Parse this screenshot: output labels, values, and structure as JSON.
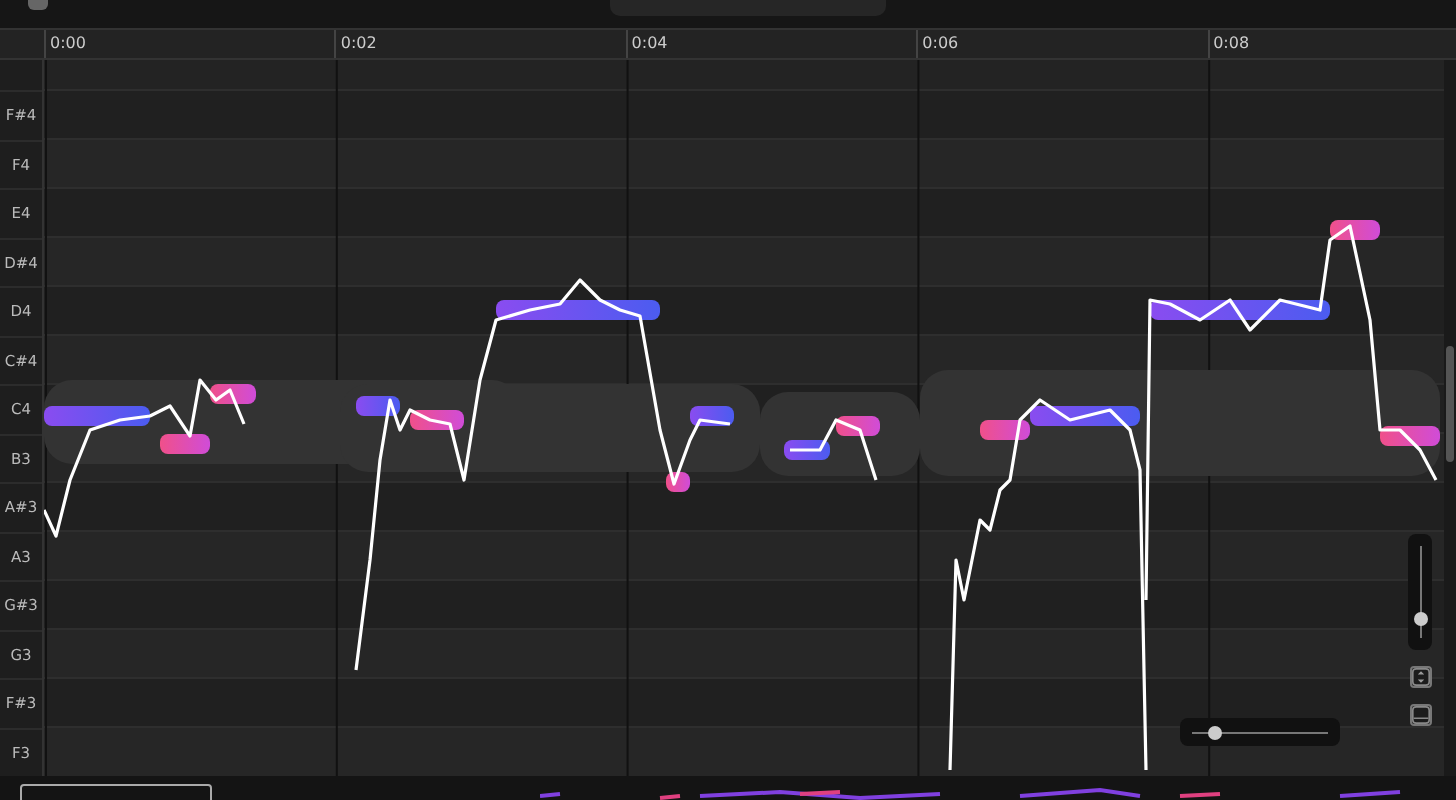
{
  "ruler": {
    "labels": [
      "0:00",
      "0:02",
      "0:04",
      "0:06",
      "0:08"
    ]
  },
  "keys": [
    {
      "label": "F#4"
    },
    {
      "label": "F4"
    },
    {
      "label": "E4"
    },
    {
      "label": "D#4"
    },
    {
      "label": "D4"
    },
    {
      "label": "C#4"
    },
    {
      "label": "C4"
    },
    {
      "label": "B3"
    },
    {
      "label": "A#3"
    },
    {
      "label": "A3"
    },
    {
      "label": "G#3"
    },
    {
      "label": "G3"
    },
    {
      "label": "F#3"
    },
    {
      "label": "F3"
    }
  ],
  "zoom": {
    "vertical": {
      "level": 0.2
    },
    "horizontal": {
      "level": 0.17
    }
  }
}
